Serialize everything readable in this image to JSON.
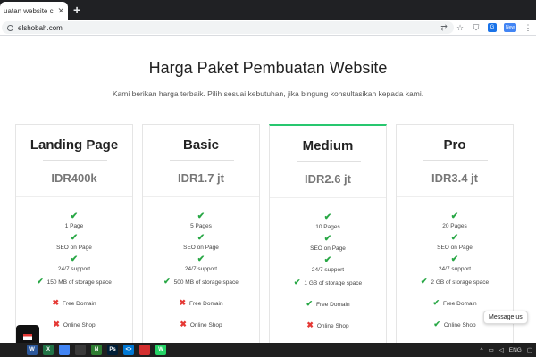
{
  "browser": {
    "tab_title": "uatan website custom",
    "tab_close": "✕",
    "new_tab": "+",
    "url": "elshobah.com"
  },
  "toolbar_icons": [
    "translate-icon",
    "star-icon",
    "shield-icon",
    "extension-icon",
    "new-extension-icon",
    "menu-icon"
  ],
  "page": {
    "title": "Harga Paket Pembuatan Website",
    "subtitle": "Kami berikan harga terbaik. Pilih sesuai kebutuhan, jika bingung konsultasikan kepada kami."
  },
  "plans": [
    {
      "name": "Landing Page",
      "price": "IDR400k",
      "features": [
        {
          "text": "1 Page",
          "included": true
        },
        {
          "text": "SEO on Page",
          "included": true
        },
        {
          "text": "24/7 support",
          "included": true
        },
        {
          "text": "150 MB of storage space",
          "included": true
        },
        {
          "text": "Free Domain",
          "included": false
        },
        {
          "text": "Online Shop",
          "included": false
        }
      ]
    },
    {
      "name": "Basic",
      "price": "IDR1.7 jt",
      "features": [
        {
          "text": "5 Pages",
          "included": true
        },
        {
          "text": "SEO on Page",
          "included": true
        },
        {
          "text": "24/7 support",
          "included": true
        },
        {
          "text": "500 MB of storage space",
          "included": true
        },
        {
          "text": "Free Domain",
          "included": false
        },
        {
          "text": "Online Shop",
          "included": false
        }
      ]
    },
    {
      "name": "Medium",
      "price": "IDR2.6 jt",
      "featured": true,
      "features": [
        {
          "text": "10 Pages",
          "included": true
        },
        {
          "text": "SEO on Page",
          "included": true
        },
        {
          "text": "24/7 support",
          "included": true
        },
        {
          "text": "1 GB of storage space",
          "included": true
        },
        {
          "text": "Free Domain",
          "included": true
        },
        {
          "text": "Online Shop",
          "included": false
        }
      ]
    },
    {
      "name": "Pro",
      "price": "IDR3.4 jt",
      "features": [
        {
          "text": "20 Pages",
          "included": true
        },
        {
          "text": "SEO on Page",
          "included": true
        },
        {
          "text": "24/7 support",
          "included": true
        },
        {
          "text": "2 GB of storage space",
          "included": true
        },
        {
          "text": "Free Domain",
          "included": true
        },
        {
          "text": "Online Shop",
          "included": true
        }
      ]
    }
  ],
  "icons": {
    "included": "✔",
    "excluded": "✖"
  },
  "colors": {
    "check": "#28a745",
    "cross": "#e53935",
    "featured_accent": "#28c76f"
  },
  "chat": {
    "label": "Message us"
  },
  "taskbar": {
    "apps": [
      {
        "name": "windows-start-icon",
        "color": "#1f1f1f",
        "label": ""
      },
      {
        "name": "word-icon",
        "color": "#2b579a",
        "label": "W"
      },
      {
        "name": "excel-icon",
        "color": "#217346",
        "label": "X"
      },
      {
        "name": "chrome-icon",
        "color": "#4285f4",
        "label": ""
      },
      {
        "name": "app-icon",
        "color": "#3a3a3a",
        "label": ""
      },
      {
        "name": "notepad-icon",
        "color": "#2e7d32",
        "label": "N"
      },
      {
        "name": "photoshop-icon",
        "color": "#001e36",
        "label": "Ps"
      },
      {
        "name": "vscode-icon",
        "color": "#0078d4",
        "label": "<>"
      },
      {
        "name": "app-red-icon",
        "color": "#d32f2f",
        "label": ""
      },
      {
        "name": "whatsapp-icon",
        "color": "#25d366",
        "label": "W"
      }
    ],
    "language": "ENG"
  }
}
